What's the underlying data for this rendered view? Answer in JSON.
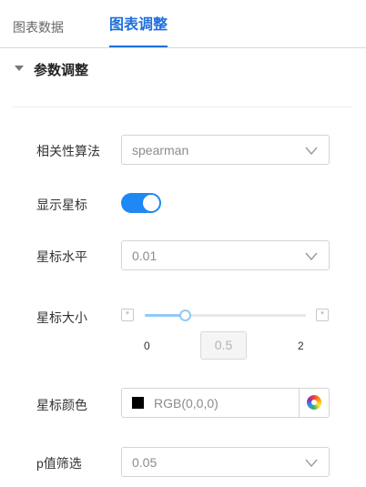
{
  "tabs": [
    {
      "label": "图表数据",
      "active": false
    },
    {
      "label": "图表调整",
      "active": true
    }
  ],
  "section": {
    "title": "参数调整",
    "expanded": true
  },
  "form": {
    "correlation_algorithm": {
      "label": "相关性算法",
      "value": "spearman"
    },
    "show_stars": {
      "label": "显示星标",
      "enabled": true
    },
    "star_level": {
      "label": "星标水平",
      "value": "0.01"
    },
    "star_size": {
      "label": "星标大小",
      "min": "0",
      "max": "2",
      "value": "0.5",
      "fraction": 0.25
    },
    "star_color": {
      "label": "星标颜色",
      "value": "RGB(0,0,0)",
      "swatch": "#000000"
    },
    "p_filter": {
      "label": "p值筛选",
      "value": "0.05"
    }
  },
  "colors": {
    "accent": "#1f6fde",
    "toggle_on": "#1e88f5",
    "slider": "#91c9f7"
  }
}
